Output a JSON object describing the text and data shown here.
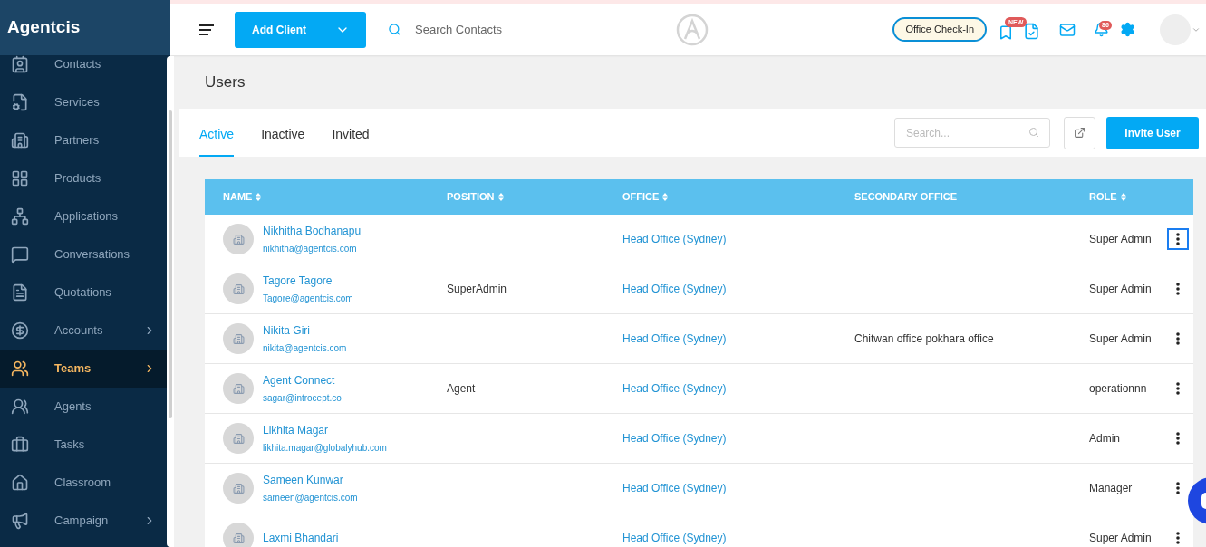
{
  "brand": "Agentcis",
  "sidebar": {
    "items": [
      {
        "label": "Contacts",
        "selected": false,
        "has_submenu": false
      },
      {
        "label": "Services",
        "selected": false,
        "has_submenu": false
      },
      {
        "label": "Partners",
        "selected": false,
        "has_submenu": false
      },
      {
        "label": "Products",
        "selected": false,
        "has_submenu": false
      },
      {
        "label": "Applications",
        "selected": false,
        "has_submenu": false
      },
      {
        "label": "Conversations",
        "selected": false,
        "has_submenu": false
      },
      {
        "label": "Quotations",
        "selected": false,
        "has_submenu": false
      },
      {
        "label": "Accounts",
        "selected": false,
        "has_submenu": true
      },
      {
        "label": "Teams",
        "selected": true,
        "has_submenu": true
      },
      {
        "label": "Agents",
        "selected": false,
        "has_submenu": false
      },
      {
        "label": "Tasks",
        "selected": false,
        "has_submenu": false
      },
      {
        "label": "Classroom",
        "selected": false,
        "has_submenu": false
      },
      {
        "label": "Campaign",
        "selected": false,
        "has_submenu": true
      }
    ]
  },
  "header": {
    "add_button": "Add Client",
    "search": {
      "placeholder": "Search Contacts"
    },
    "checkin_button": "Office Check-In",
    "new_badge": "NEW",
    "notification_count": "86"
  },
  "page": {
    "title": "Users",
    "tabs": [
      {
        "label": "Active",
        "selected": true
      },
      {
        "label": "Inactive",
        "selected": false
      },
      {
        "label": "Invited",
        "selected": false
      }
    ],
    "search": {
      "placeholder": "Search..."
    },
    "invite_button": "Invite User"
  },
  "table": {
    "columns": [
      {
        "label": "NAME",
        "sortable": true
      },
      {
        "label": "POSITION",
        "sortable": true
      },
      {
        "label": "OFFICE",
        "sortable": true
      },
      {
        "label": "SECONDARY OFFICE",
        "sortable": false
      },
      {
        "label": "ROLE",
        "sortable": true
      }
    ],
    "rows": [
      {
        "name": "Nikhitha Bodhanapu",
        "email": "nikhitha@agentcis.com",
        "position": "",
        "office": "Head Office (Sydney)",
        "secondary_office": "",
        "role": "Super Admin",
        "focused": true
      },
      {
        "name": "Tagore Tagore",
        "email": "Tagore@agentcis.com",
        "position": "SuperAdmin",
        "office": "Head Office (Sydney)",
        "secondary_office": "",
        "role": "Super Admin",
        "focused": false
      },
      {
        "name": "Nikita Giri",
        "email": "nikita@agentcis.com",
        "position": "",
        "office": "Head Office (Sydney)",
        "secondary_office": "Chitwan office pokhara office",
        "role": "Super Admin",
        "focused": false
      },
      {
        "name": "Agent Connect",
        "email": "sagar@introcept.co",
        "position": "Agent",
        "office": "Head Office (Sydney)",
        "secondary_office": "",
        "role": "operationnn",
        "focused": false
      },
      {
        "name": "Likhita Magar",
        "email": "likhita.magar@globalyhub.com",
        "position": "",
        "office": "Head Office (Sydney)",
        "secondary_office": "",
        "role": "Admin",
        "focused": false
      },
      {
        "name": "Sameen Kunwar",
        "email": "sameen@agentcis.com",
        "position": "",
        "office": "Head Office (Sydney)",
        "secondary_office": "",
        "role": "Manager",
        "focused": false
      },
      {
        "name": "Laxmi Bhandari",
        "email": "",
        "position": "",
        "office": "Head Office (Sydney)",
        "secondary_office": "",
        "role": "Super Admin",
        "focused": false
      }
    ]
  }
}
